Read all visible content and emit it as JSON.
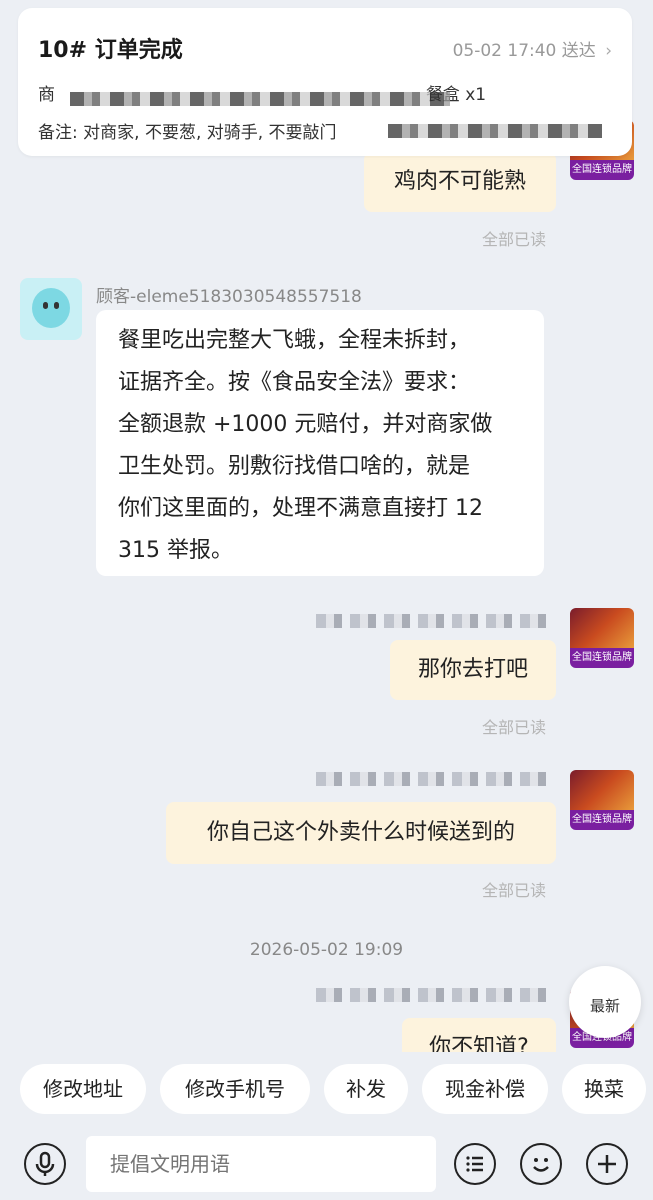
{
  "order": {
    "title": "10# 订单完成",
    "time": "05-02 17:40 送达",
    "line1_prefix": "商",
    "line1_suffix": "餐盒 x1",
    "line2_prefix": "备注: 对商家, 不要葱, 对骑手, 不要敲门"
  },
  "messages": {
    "m1_text": "鸡肉不可能熟",
    "m1_read": "全部已读",
    "customer_name": "顾客-eleme5183030548557518",
    "customer_lines": [
      "餐里吃出完整大飞蛾，全程未拆封，",
      "证据齐全。按《食品安全法》要求：",
      "全额退款 +1000 元赔付，并对商家做",
      "卫生处罚。别敷衍找借口啥的，就是",
      "你们这里面的，处理不满意直接打 12",
      "315 举报。"
    ],
    "m2_text": "那你去打吧",
    "m2_read": "全部已读",
    "m3_text": "你自己这个外卖什么时候送到的",
    "m3_read": "全部已读",
    "timestamp": "2026-05-02 19:09",
    "m4_text": "你不知道?",
    "merchant_badge": "全国连锁品牌"
  },
  "latest_button": "最新",
  "quick_replies": [
    "修改地址",
    "修改手机号",
    "补发",
    "现金补偿",
    "换菜"
  ],
  "input": {
    "placeholder": "提倡文明用语"
  }
}
